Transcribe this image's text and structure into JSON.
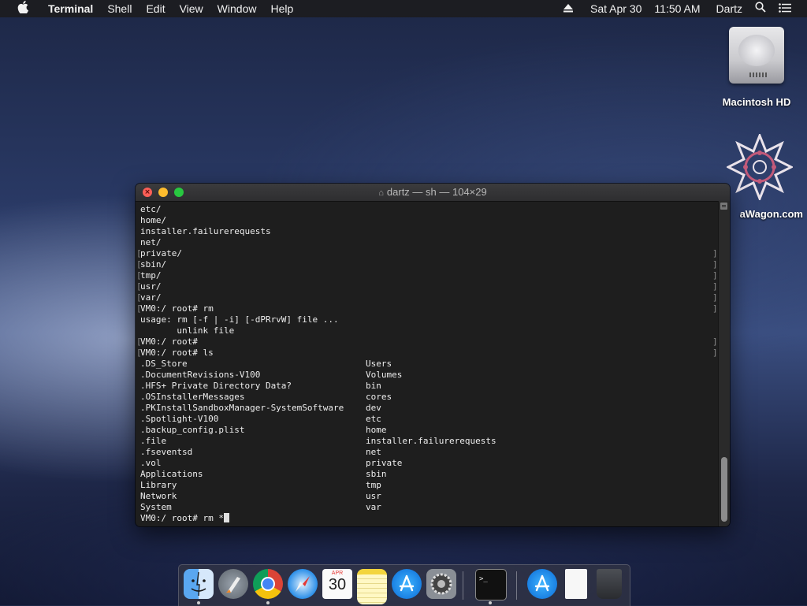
{
  "menubar": {
    "apple_icon": "apple-icon",
    "app_name": "Terminal",
    "items": [
      "Shell",
      "Edit",
      "View",
      "Window",
      "Help"
    ],
    "date": "Sat Apr 30",
    "time": "11:50 AM",
    "user": "Dartz"
  },
  "desktop": {
    "hd_label": "Macintosh HD",
    "second_label": "aWagon.com"
  },
  "terminal": {
    "title": "dartz — sh — 104×29",
    "lines": [
      "etc/",
      "home/",
      "installer.failurerequests",
      "net/",
      "private/",
      "sbin/",
      "tmp/",
      "usr/",
      "var/",
      "VM0:/ root# rm",
      "usage: rm [-f | -i] [-dPRrvW] file ...",
      "       unlink file",
      "VM0:/ root#",
      "VM0:/ root# ls"
    ],
    "ls_left": [
      ".DS_Store",
      ".DocumentRevisions-V100",
      ".HFS+ Private Directory Data?",
      ".OSInstallerMessages",
      ".PKInstallSandboxManager-SystemSoftware",
      ".Spotlight-V100",
      ".backup_config.plist",
      ".file",
      ".fseventsd",
      ".vol",
      "Applications",
      "Library",
      "Network",
      "System"
    ],
    "ls_right": [
      "Users",
      "Volumes",
      "bin",
      "cores",
      "dev",
      "etc",
      "home",
      "installer.failurerequests",
      "net",
      "private",
      "sbin",
      "tmp",
      "usr",
      "var"
    ],
    "prompt_line": "VM0:/ root# rm *"
  },
  "dock": {
    "calendar_month": "APR",
    "calendar_day": "30"
  }
}
